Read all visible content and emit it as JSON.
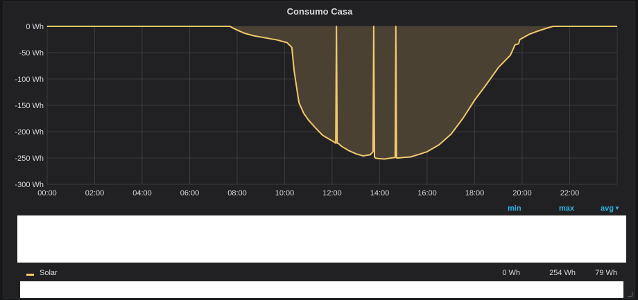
{
  "panel": {
    "title": "Consumo Casa"
  },
  "legend": {
    "headers": {
      "min": "min",
      "max": "max",
      "avg": "avg"
    },
    "series": [
      {
        "label": "Solar",
        "min": "0 Wh",
        "max": "254 Wh",
        "avg": "79 Wh",
        "color": "#f2c96d"
      }
    ]
  },
  "colors": {
    "background": "#212124",
    "grid": "#3a3a3d",
    "line": "#f2c96d",
    "fill": "#4a4133",
    "link": "#33b5e5"
  },
  "chart_data": {
    "type": "area",
    "title": "Consumo Casa",
    "xlabel": "",
    "ylabel": "",
    "grid": true,
    "legend_position": "bottom",
    "x_unit": "hour of day",
    "xlim": [
      0,
      24
    ],
    "ylim": [
      -300,
      0
    ],
    "y_ticks": [
      {
        "value": 0,
        "label": "0 Wh"
      },
      {
        "value": -50,
        "label": "-50 Wh"
      },
      {
        "value": -100,
        "label": "-100 Wh"
      },
      {
        "value": -150,
        "label": "-150 Wh"
      },
      {
        "value": -200,
        "label": "-200 Wh"
      },
      {
        "value": -250,
        "label": "-250 Wh"
      },
      {
        "value": -300,
        "label": "-300 Wh"
      }
    ],
    "x_ticks": [
      {
        "value": 0,
        "label": "00:00"
      },
      {
        "value": 2,
        "label": "02:00"
      },
      {
        "value": 4,
        "label": "04:00"
      },
      {
        "value": 6,
        "label": "06:00"
      },
      {
        "value": 8,
        "label": "08:00"
      },
      {
        "value": 10,
        "label": "10:00"
      },
      {
        "value": 12,
        "label": "12:00"
      },
      {
        "value": 14,
        "label": "14:00"
      },
      {
        "value": 16,
        "label": "16:00"
      },
      {
        "value": 18,
        "label": "18:00"
      },
      {
        "value": 20,
        "label": "20:00"
      },
      {
        "value": 22,
        "label": "22:00"
      }
    ],
    "series": [
      {
        "name": "Solar",
        "x": [
          0,
          7.7,
          7.85,
          8.0,
          8.3,
          8.7,
          9.2,
          9.7,
          10.1,
          10.3,
          10.4,
          10.5,
          10.6,
          10.8,
          11.0,
          11.3,
          11.6,
          11.9,
          12.1,
          12.15,
          12.18,
          12.21,
          12.25,
          12.4,
          12.7,
          13.0,
          13.3,
          13.6,
          13.72,
          13.75,
          13.78,
          13.82,
          13.9,
          14.2,
          14.5,
          14.65,
          14.68,
          14.71,
          14.74,
          14.8,
          15.0,
          15.3,
          15.6,
          16.0,
          16.5,
          17.0,
          17.5,
          18.0,
          18.5,
          19.0,
          19.5,
          19.7,
          19.8,
          19.85,
          19.9,
          20.1,
          20.3,
          20.6,
          21.0,
          21.3,
          21.4,
          24
        ],
        "y": [
          0,
          0,
          -4,
          -7,
          -13,
          -18,
          -22,
          -26,
          -31,
          -40,
          -85,
          -115,
          -145,
          -165,
          -178,
          -193,
          -207,
          -215,
          -220,
          -222,
          0,
          -222,
          -222,
          -228,
          -236,
          -242,
          -246,
          -244,
          -238,
          0,
          -248,
          -250,
          -251,
          -252,
          -250,
          -249,
          0,
          -250,
          -250,
          -250,
          -249,
          -248,
          -244,
          -238,
          -225,
          -205,
          -175,
          -140,
          -110,
          -78,
          -55,
          -35,
          -34,
          -33,
          -25,
          -20,
          -15,
          -10,
          -4,
          0,
          0,
          0
        ]
      }
    ]
  }
}
